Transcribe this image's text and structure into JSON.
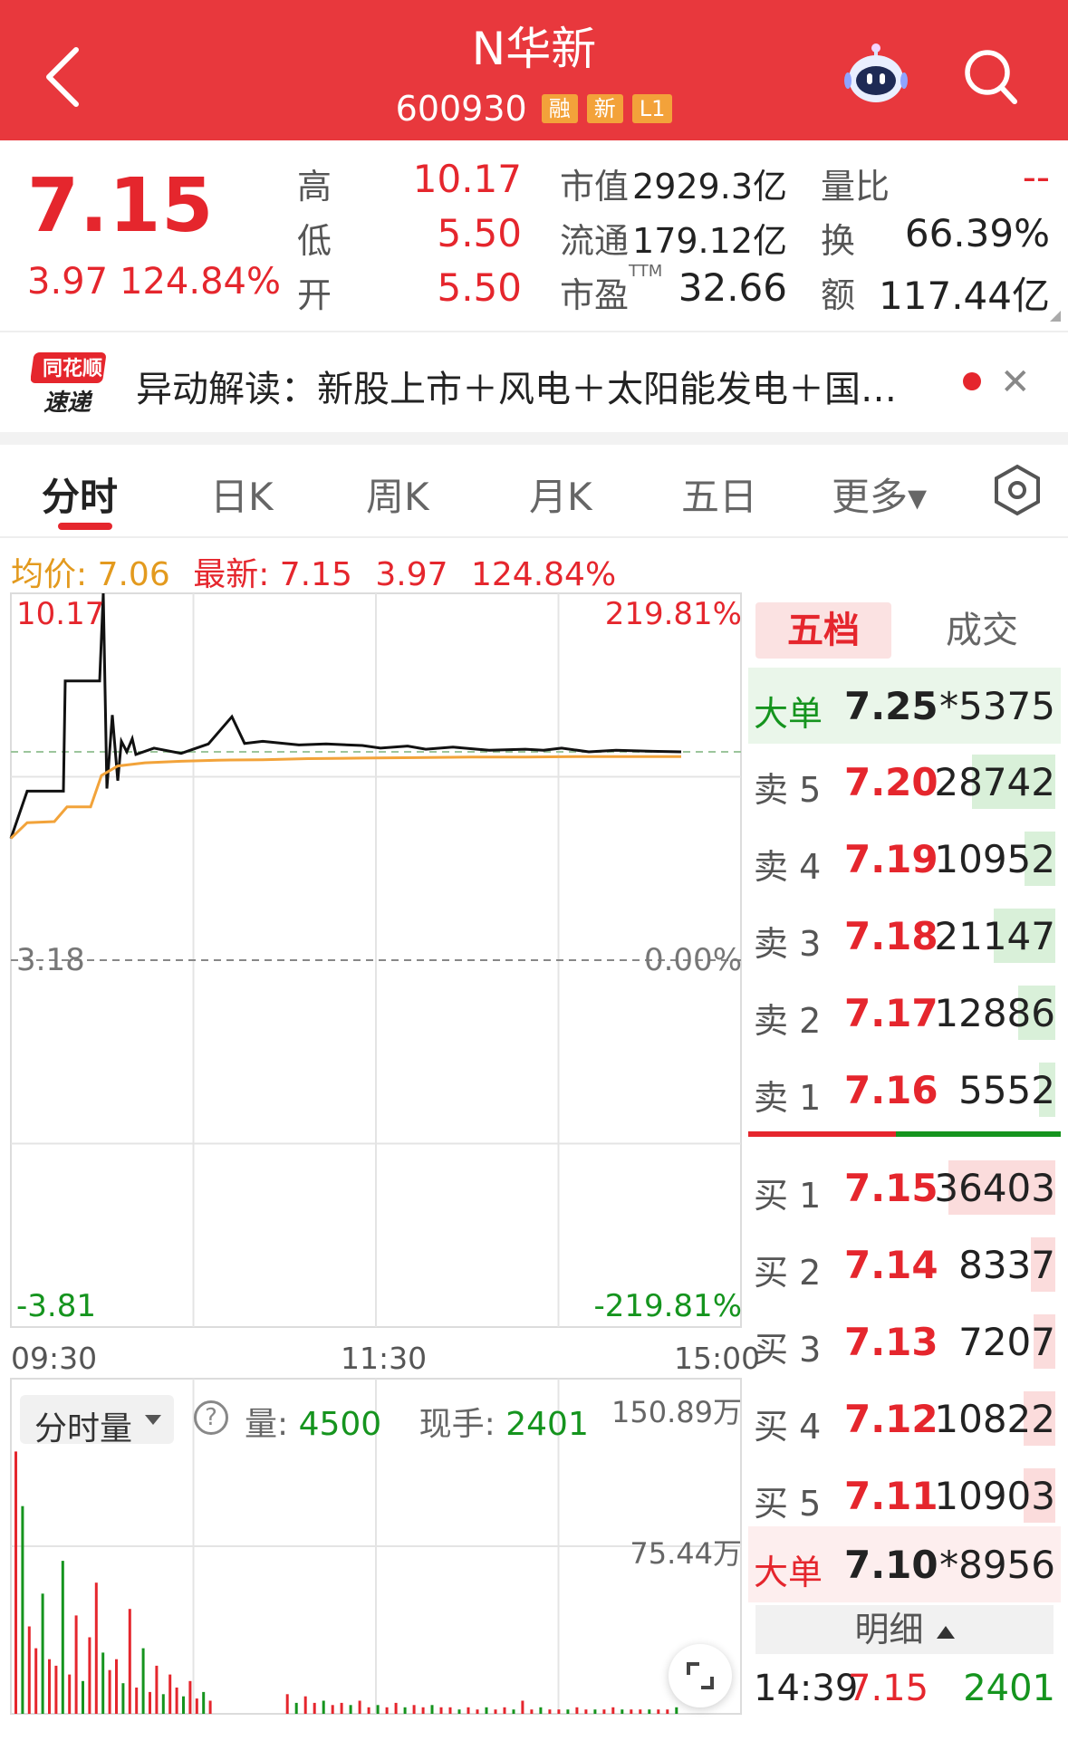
{
  "header": {
    "title": "N华新",
    "code": "600930",
    "tags": [
      "融",
      "新",
      "L1"
    ],
    "bg_color": "#e8383d"
  },
  "quote": {
    "price": "7.15",
    "change": "3.97",
    "change_pct": "124.84%",
    "high_label": "高",
    "high": "10.17",
    "low_label": "低",
    "low": "5.50",
    "open_label": "开",
    "open": "5.50",
    "mktcap_label": "市值",
    "mktcap": "2929.3亿",
    "float_label": "流通",
    "float": "179.12亿",
    "pe_label": "市盈",
    "pe_sup": "TTM",
    "pe": "32.66",
    "vol_ratio_label": "量比",
    "vol_ratio": "--",
    "turnover_label": "换",
    "turnover": "66.39%",
    "amount_label": "额",
    "amount": "117.44亿"
  },
  "news": {
    "logo_top": "同花顺",
    "logo_bottom": "速递",
    "text": "异动解读：新股上市＋风电＋太阳能发电＋国…"
  },
  "tabs": [
    "分时",
    "日K",
    "周K",
    "月K",
    "五日",
    "更多▾"
  ],
  "info_line": {
    "avg_label": "均价: 7.06",
    "latest_label": "最新: 7.15",
    "change": "3.97",
    "change_pct": "124.84%"
  },
  "chart_axes": {
    "top_price": "10.17",
    "top_pct": "219.81%",
    "mid_price": "3.18",
    "mid_pct": "0.00%",
    "bottom_price": "-3.81",
    "bottom_pct": "-219.81%",
    "times": [
      "09:30",
      "11:30",
      "15:00"
    ]
  },
  "chart_data": {
    "type": "line",
    "title": "",
    "ylim": [
      -3.81,
      10.17
    ],
    "reference_price": 3.18,
    "series": [
      {
        "name": "",
        "color": "#111111",
        "values": [
          5.5,
          6.4,
          6.4,
          8.5,
          8.5,
          10.17,
          6.45,
          7.85,
          6.6,
          7.35,
          7.15,
          7.4,
          7.1,
          7.22,
          7.12,
          7.3,
          7.82,
          7.31,
          7.35,
          7.28,
          7.3,
          7.27,
          7.22,
          7.26,
          7.2,
          7.24,
          7.18,
          7.2,
          7.18,
          7.22,
          7.15,
          7.18,
          7.16,
          7.15
        ]
      },
      {
        "name": "",
        "color": "#f2a33a",
        "values": [
          5.5,
          5.8,
          5.82,
          6.1,
          6.1,
          6.7,
          6.88,
          6.94,
          6.97,
          6.99,
          7.0,
          7.02,
          7.03,
          7.04,
          7.05,
          7.05,
          7.06,
          7.06,
          7.06
        ]
      }
    ],
    "volume": {
      "max_label": "150.89万",
      "mid_label": "75.44万",
      "values": [
        120,
        95,
        40,
        30,
        55,
        25,
        22,
        70,
        18,
        45,
        15,
        35,
        60,
        28,
        20,
        25,
        14,
        48,
        12,
        30,
        10,
        22,
        9,
        18,
        12,
        8,
        15,
        7,
        10,
        6,
        9,
        5,
        8,
        5,
        6,
        4,
        5,
        4,
        6,
        3,
        4,
        3,
        5,
        3,
        4,
        3,
        4,
        3,
        3,
        2,
        3,
        2,
        3,
        2,
        3,
        2,
        6,
        2,
        3,
        2,
        2,
        2,
        3,
        2,
        2,
        2,
        3,
        2,
        2,
        2,
        2,
        2,
        2,
        3,
        2,
        2,
        2,
        2,
        2,
        2
      ]
    }
  },
  "volume_panel": {
    "selector_label": "分时量",
    "help": "?",
    "vol_label": "量: ",
    "vol_value": "4500",
    "hand_label": "现手: ",
    "hand_value": "2401"
  },
  "order_book": {
    "tab_five": "五档",
    "tab_trades": "成交",
    "big_sell": {
      "label": "大单",
      "price": "7.25",
      "vol": "*5375"
    },
    "asks": [
      {
        "label": "卖 5",
        "price": "7.20",
        "vol": "28742",
        "ratio": 0.78
      },
      {
        "label": "卖 4",
        "price": "7.19",
        "vol": "10952",
        "ratio": 0.29
      },
      {
        "label": "卖 3",
        "price": "7.18",
        "vol": "21147",
        "ratio": 0.58
      },
      {
        "label": "卖 2",
        "price": "7.17",
        "vol": "12886",
        "ratio": 0.35
      },
      {
        "label": "卖 1",
        "price": "7.16",
        "vol": "5552",
        "ratio": 0.15
      }
    ],
    "bids": [
      {
        "label": "买 1",
        "price": "7.15",
        "vol": "36403",
        "ratio": 1.0
      },
      {
        "label": "买 2",
        "price": "7.14",
        "vol": "8337",
        "ratio": 0.23
      },
      {
        "label": "买 3",
        "price": "7.13",
        "vol": "7207",
        "ratio": 0.2
      },
      {
        "label": "买 4",
        "price": "7.12",
        "vol": "10822",
        "ratio": 0.3
      },
      {
        "label": "买 5",
        "price": "7.11",
        "vol": "10903",
        "ratio": 0.3
      }
    ],
    "big_buy": {
      "label": "大单",
      "price": "7.10",
      "vol": "*8956"
    },
    "detail_header": "明细",
    "detail": {
      "time": "14:39",
      "price": "7.15",
      "vol": "2401"
    }
  }
}
